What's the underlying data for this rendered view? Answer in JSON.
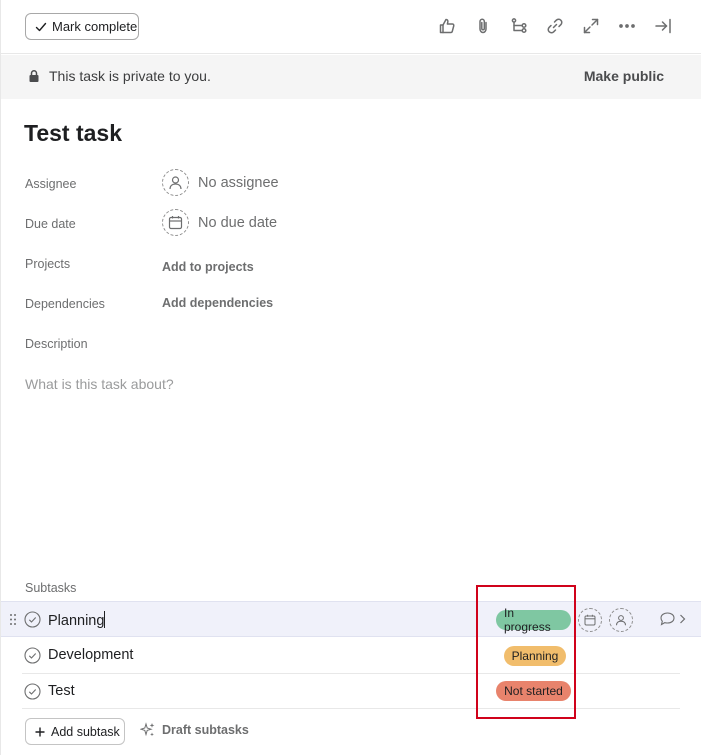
{
  "toolbar": {
    "mark_complete_label": "Mark complete",
    "icons": [
      "like-icon",
      "attachment-icon",
      "subtask-icon",
      "link-icon",
      "expand-icon",
      "more-icon",
      "close-panel-icon"
    ]
  },
  "banner": {
    "text": "This task is private to you.",
    "action": "Make public"
  },
  "task": {
    "title": "Test task"
  },
  "fields": {
    "assignee_label": "Assignee",
    "assignee_value": "No assignee",
    "due_date_label": "Due date",
    "due_date_value": "No due date",
    "projects_label": "Projects",
    "projects_action": "Add to projects",
    "dependencies_label": "Dependencies",
    "dependencies_action": "Add dependencies",
    "description_label": "Description",
    "description_placeholder": "What is this task about?"
  },
  "subtasks": {
    "label": "Subtasks",
    "items": [
      {
        "name": "Planning",
        "status": "In progress",
        "status_color": "#7fc7a2"
      },
      {
        "name": "Development",
        "status": "Planning",
        "status_color": "#f1bd6c"
      },
      {
        "name": "Test",
        "status": "Not started",
        "status_color": "#e8836c"
      }
    ],
    "add_label": "Add subtask",
    "draft_label": "Draft subtasks"
  },
  "colors": {
    "highlight": "#d0021b",
    "hover_row": "#f0f1fa"
  }
}
